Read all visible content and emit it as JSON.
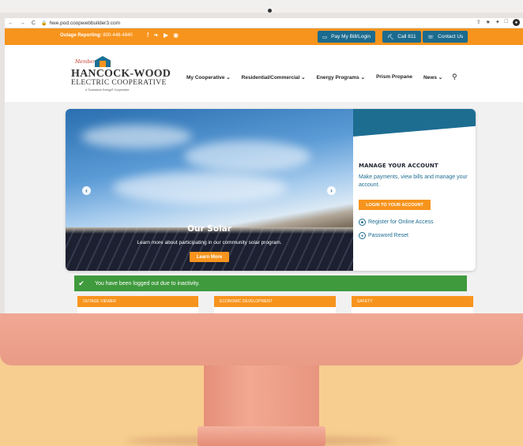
{
  "browser": {
    "nav": "← → C",
    "url": "hwe.pod.coopwebbuilder3.com"
  },
  "topbar": {
    "outage_label": "Outage Reporting:",
    "outage_number": "800-446-4840",
    "social": [
      "facebook-icon",
      "twitter-icon",
      "youtube-icon",
      "instagram-icon"
    ],
    "buttons": [
      {
        "label": "Pay My Bill/Login",
        "icon": "card-icon"
      },
      {
        "label": "Call 811",
        "icon": "shovel-icon"
      },
      {
        "label": "Contact Us",
        "icon": "headset-icon"
      }
    ]
  },
  "logo": {
    "tagline": "Members First",
    "line1": "HANCOCK-WOOD",
    "line2": "ELECTRIC COOPERATIVE",
    "line3": "A Touchstone Energy® Cooperative"
  },
  "menu": [
    "My Cooperative ⌄",
    "Residential/Commercial ⌄",
    "Energy Programs ⌄",
    "Prism Propane",
    "News ⌄"
  ],
  "hero": {
    "title": "Our Solar",
    "description": "Learn more about participating in our community solar program.",
    "button": "Learn More"
  },
  "account": {
    "heading": "MANAGE YOUR ACCOUNT",
    "description": "Make payments, view bills and manage your account.",
    "login_button": "LOGIN TO YOUR ACCOUNT",
    "register": "Register for Online Access",
    "reset": "Password Reset"
  },
  "alert": {
    "message": "You have been logged out due to inactivity."
  },
  "cards": [
    "OUTAGE VIEWER",
    "ECONOMIC DEVELOPMENT",
    "SAFETY"
  ],
  "colors": {
    "brand_orange": "#f7941d",
    "brand_blue": "#1d6d91",
    "success_green": "#3f9a3d",
    "background": "#f7ce8f",
    "monitor_pink": "#f0a894"
  }
}
